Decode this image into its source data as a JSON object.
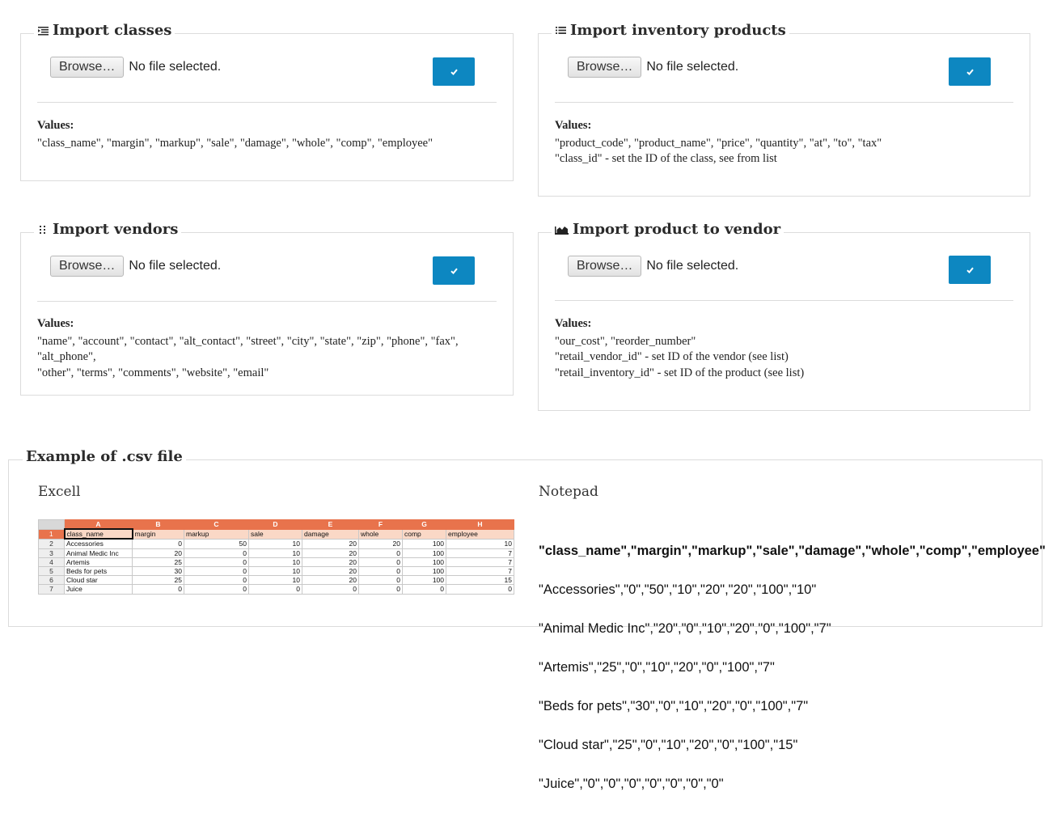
{
  "common": {
    "browse_label": "Browse…",
    "no_file": "No file selected.",
    "values_label": "Values:",
    "submit_glyph": "✔"
  },
  "panels": {
    "classes": {
      "title": "Import classes",
      "icon": "indent-list-icon",
      "values": [
        "\"class_name\", \"margin\", \"markup\", \"sale\", \"damage\", \"whole\", \"comp\", \"employee\""
      ]
    },
    "inventory": {
      "title": "Import inventory products",
      "icon": "list-icon",
      "values": [
        "\"product_code\", \"product_name\", \"price\", \"quantity\", \"at\", \"to\", \"tax\"",
        "\"class_id\" - set the ID of the class, see from list"
      ]
    },
    "vendors": {
      "title": "Import vendors",
      "icon": "dots-grid-icon",
      "values": [
        "\"name\", \"account\", \"contact\", \"alt_contact\", \"street\", \"city\", \"state\", \"zip\", \"phone\", \"fax\", \"alt_phone\",",
        "\"other\", \"terms\", \"comments\", \"website\", \"email\""
      ]
    },
    "product_vendor": {
      "title": "Import product to vendor",
      "icon": "area-chart-icon",
      "values": [
        "\"our_cost\", \"reorder_number\"",
        "\"retail_vendor_id\" - set ID of the vendor (see list)",
        "\"retail_inventory_id\" - set ID of the product (see list)"
      ]
    }
  },
  "example": {
    "title": "Example of .csv file",
    "excel_label": "Excell",
    "notepad_label": "Notepad",
    "spreadsheet": {
      "columns": [
        "A",
        "B",
        "C",
        "D",
        "E",
        "F",
        "G",
        "H"
      ],
      "rows": [
        [
          "1",
          "class_name",
          "margin",
          "markup",
          "sale",
          "damage",
          "whole",
          "comp",
          "employee"
        ],
        [
          "2",
          "Accessories",
          "0",
          "50",
          "10",
          "20",
          "20",
          "100",
          "10"
        ],
        [
          "3",
          "Animal Medic Inc",
          "20",
          "0",
          "10",
          "20",
          "0",
          "100",
          "7"
        ],
        [
          "4",
          "Artemis",
          "25",
          "0",
          "10",
          "20",
          "0",
          "100",
          "7"
        ],
        [
          "5",
          "Beds for pets",
          "30",
          "0",
          "10",
          "20",
          "0",
          "100",
          "7"
        ],
        [
          "6",
          "Cloud star",
          "25",
          "0",
          "10",
          "20",
          "0",
          "100",
          "15"
        ],
        [
          "7",
          "Juice",
          "0",
          "0",
          "0",
          "0",
          "0",
          "0",
          "0"
        ]
      ]
    },
    "notepad_lines": [
      "\"class_name\",\"margin\",\"markup\",\"sale\",\"damage\",\"whole\",\"comp\",\"employee\"",
      "\"Accessories\",\"0\",\"50\",\"10\",\"20\",\"20\",\"100\",\"10\"",
      "\"Animal Medic Inc\",\"20\",\"0\",\"10\",\"20\",\"0\",\"100\",\"7\"",
      "\"Artemis\",\"25\",\"0\",\"10\",\"20\",\"0\",\"100\",\"7\"",
      "\"Beds for pets\",\"30\",\"0\",\"10\",\"20\",\"0\",\"100\",\"7\"",
      "\"Cloud star\",\"25\",\"0\",\"10\",\"20\",\"0\",\"100\",\"15\"",
      "\"Juice\",\"0\",\"0\",\"0\",\"0\",\"0\",\"0\",\"0\""
    ]
  }
}
